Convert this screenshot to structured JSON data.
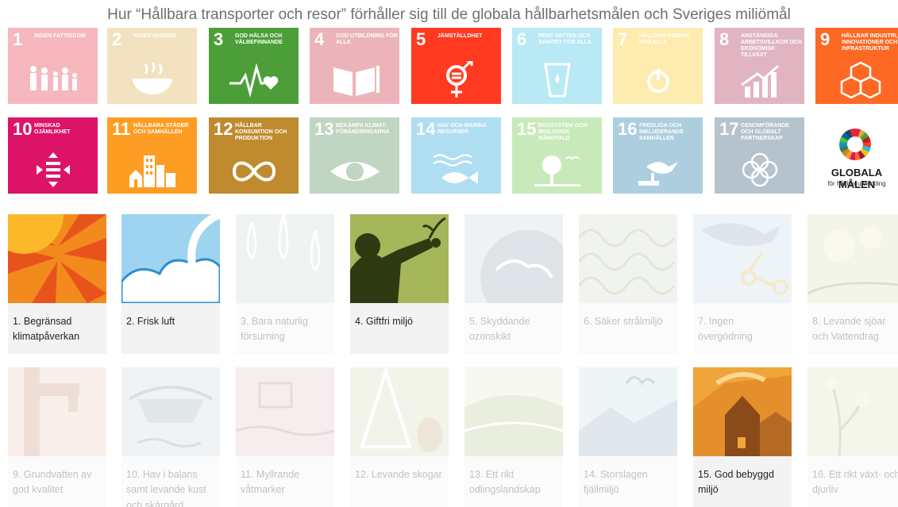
{
  "title": "Hur “Hållbara transporter och resor” förhåller sig till de globala hållbarhetsmålen och Sveriges miliömål",
  "sdg_row1": [
    {
      "num": "1",
      "label": "INGEN FATTIGDOM",
      "color": "#e5243b",
      "active": false
    },
    {
      "num": "2",
      "label": "INGEN HUNGER",
      "color": "#dda63a",
      "active": false
    },
    {
      "num": "3",
      "label": "GOD HÄLSA OCH VÄLBEFINNANDE",
      "color": "#4c9f38",
      "active": true
    },
    {
      "num": "4",
      "label": "GOD UTBILDNING FÖR ALLA",
      "color": "#c5192d",
      "active": false
    },
    {
      "num": "5",
      "label": "JÄMSTÄLLDHET",
      "color": "#ff3a21",
      "active": true
    },
    {
      "num": "6",
      "label": "RENT VATTEN OCH SANITET FÖR ALLA",
      "color": "#26bde2",
      "active": false
    },
    {
      "num": "7",
      "label": "HÅLLBAR ENERGI FÖR ALLA",
      "color": "#fcc30b",
      "active": false
    },
    {
      "num": "8",
      "label": "ANSTÄNDIGA ARBETSVILLKOR OCH EKONOMISK TILLVÄXT",
      "color": "#a21942",
      "active": false
    },
    {
      "num": "9",
      "label": "HÅLLBAR INDUSTRI, INNOVATIONER OCH INFRASTRUKTUR",
      "color": "#fd6925",
      "active": true
    }
  ],
  "sdg_row2": [
    {
      "num": "10",
      "label": "MINSKAD OJÄMLIKHET",
      "color": "#dd1367",
      "active": true
    },
    {
      "num": "11",
      "label": "HÅLLBARA STÄDER OCH SAMHÄLLEN",
      "color": "#fd9d24",
      "active": true
    },
    {
      "num": "12",
      "label": "HÅLLBAR KONSUMTION OCH PRODUKTION",
      "color": "#bf8b2e",
      "active": true
    },
    {
      "num": "13",
      "label": "BEKÄMPA KLIMAT-FÖRÄNDRINGARNA",
      "color": "#3f7e44",
      "active": false
    },
    {
      "num": "14",
      "label": "HAV OCH MARINA RESURSER",
      "color": "#0a97d9",
      "active": false
    },
    {
      "num": "15",
      "label": "EKOSYSTEM OCH BIOLOGISK MÅNGFALD",
      "color": "#56c02b",
      "active": false
    },
    {
      "num": "16",
      "label": "FREDLIGA OCH INKLUDERANDE SAMHÄLLEN",
      "color": "#00689d",
      "active": false
    },
    {
      "num": "17",
      "label": "GENOMFÖRANDE OCH GLOBALT PARTNERSKAP",
      "color": "#19486a",
      "active": false
    }
  ],
  "globala_malen": {
    "title": "GLOBALA MÅLEN",
    "subtitle": "för hållbar utveckling"
  },
  "goals_row1": [
    {
      "caption": "1. Begränsad klimatpåverkan",
      "active": true,
      "icon": "sun-icon"
    },
    {
      "caption": "2. Frisk luft",
      "active": true,
      "icon": "cloud-icon"
    },
    {
      "caption": "3. Bara naturlig försurning",
      "active": false,
      "icon": "raindrop-icon"
    },
    {
      "caption": "4. Giftfri miljö",
      "active": true,
      "icon": "person-plant-icon"
    },
    {
      "caption": "5. Skyddande ozonskikt",
      "active": false,
      "icon": "globe-icon"
    },
    {
      "caption": "6. Säker strålmiljö",
      "active": false,
      "icon": "wave-icon"
    },
    {
      "caption": "7. Ingen övergödning",
      "active": false,
      "icon": "fish-molecule-icon"
    },
    {
      "caption": "8. Levande sjöar och Vattendrag",
      "active": false,
      "icon": "flower-icon"
    }
  ],
  "goals_row2": [
    {
      "caption": "9. Grundvatten av god kvalitet",
      "active": false,
      "icon": "tap-icon"
    },
    {
      "caption": "10. Hav i balans samt levande kust och skärgård",
      "active": false,
      "icon": "boat-icon"
    },
    {
      "caption": "11. Myllrande våtmarker",
      "active": false,
      "icon": "wetland-icon"
    },
    {
      "caption": "12. Levande skogar",
      "active": false,
      "icon": "tree-icon"
    },
    {
      "caption": "13. Ett rikt odlingslandskap",
      "active": false,
      "icon": "field-icon"
    },
    {
      "caption": "14. Storslagen fjällmiljö",
      "active": false,
      "icon": "mountain-icon"
    },
    {
      "caption": "15. God bebyggd miljö",
      "active": true,
      "icon": "house-icon"
    },
    {
      "caption": "16. Ett rikt växt- och djurliv",
      "active": false,
      "icon": "plant-icon"
    }
  ]
}
